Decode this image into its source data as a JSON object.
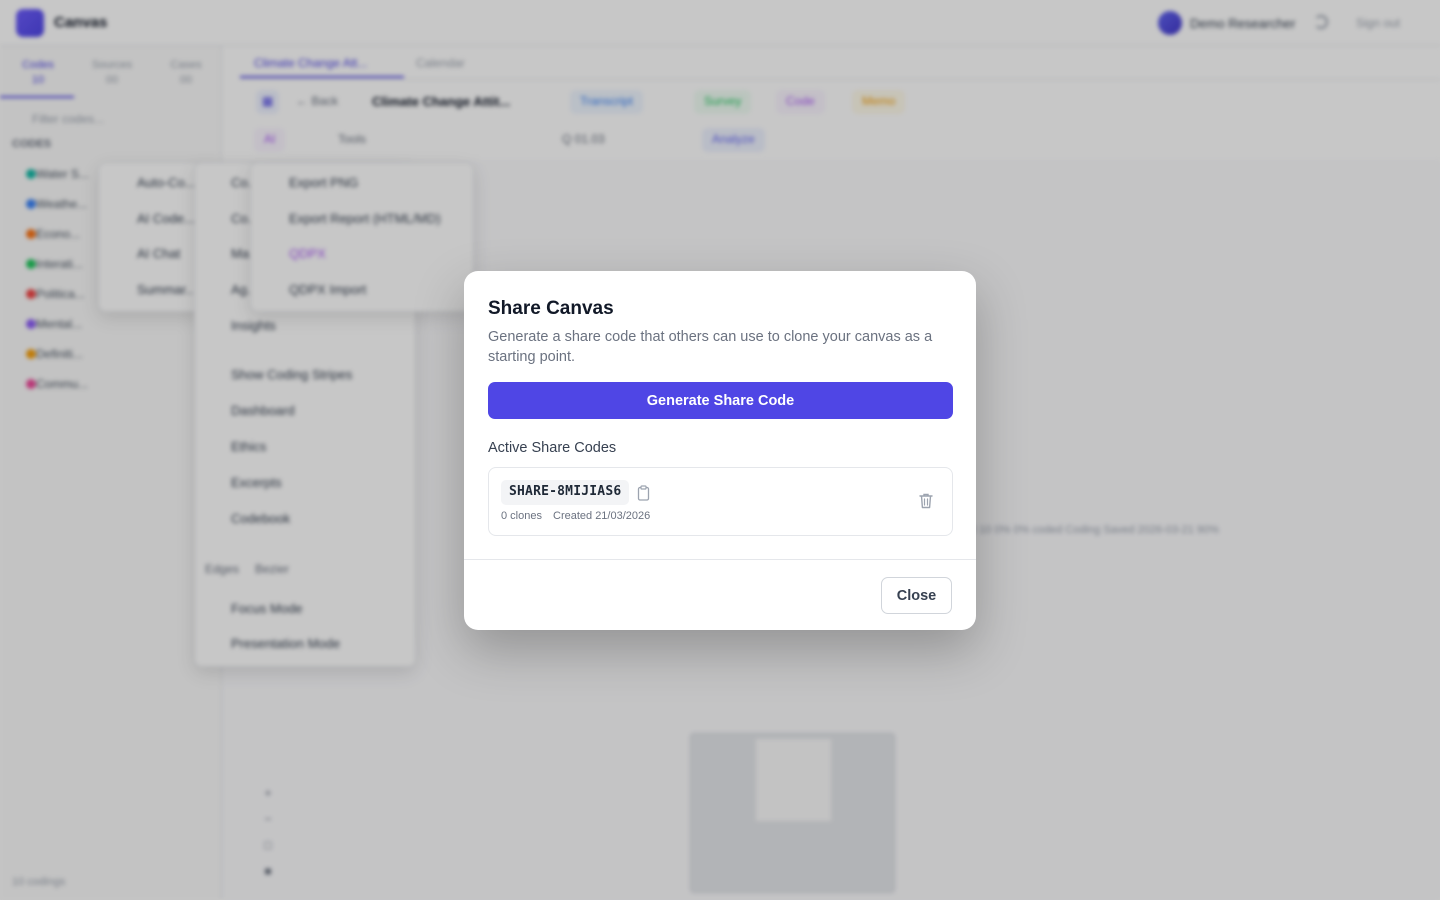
{
  "background": {
    "app_title": "Canvas",
    "user_name": "Demo Researcher",
    "sign_out": "Sign out",
    "sidebar_tabs": [
      {
        "label": "Codes",
        "count": "10"
      },
      {
        "label": "Sources",
        "count": "00"
      },
      {
        "label": "Cases",
        "count": "00"
      }
    ],
    "filter_placeholder": "Filter codes...",
    "codes_heading": "CODES",
    "codes": [
      {
        "label": "Water S...",
        "color": "#14b8a6"
      },
      {
        "label": "Weathe...",
        "color": "#3b82f6"
      },
      {
        "label": "Econo...",
        "color": "#f97316"
      },
      {
        "label": "Interati...",
        "color": "#22c55e"
      },
      {
        "label": "Politica...",
        "color": "#ef4444"
      },
      {
        "label": "Mental...",
        "color": "#8b5cf6"
      },
      {
        "label": "Definiti...",
        "color": "#f59e0b"
      },
      {
        "label": "Commu...",
        "color": "#ec4899"
      }
    ],
    "sidebar_footer": "10 codings",
    "doc_tabs": [
      "Climate Change Att...",
      "Calendar"
    ],
    "back_label": "Back",
    "doc_title": "Climate Change Attit...",
    "toolbar_pills": [
      {
        "label": "Transcript",
        "color": "#3b82f6"
      },
      {
        "label": "Survey",
        "color": "#22c55e"
      },
      {
        "label": "Code",
        "color": "#a855f7"
      },
      {
        "label": "Memo",
        "color": "#f59e0b"
      }
    ],
    "toolbar2": {
      "ai": "AI",
      "tools": "Tools",
      "zoom": "Q 01.03",
      "analyze": "Analyze"
    },
    "menu_left": [
      "Auto-Co...",
      "AI Code...",
      "AI Chat",
      "Summar..."
    ],
    "menu_mid": [
      "Co...",
      "Co...",
      "Ma...",
      "Ag...",
      "Insights",
      "Show Coding Stripes",
      "Dashboard",
      "Ethics",
      "Excerpts",
      "Codebook",
      "Focus Mode",
      "Presentation Mode"
    ],
    "edges_label": "Edges",
    "edges_value": "Bezier",
    "menu_right": [
      "Export PNG",
      "Export Report (HTML/MD)",
      "QDPX",
      "QDPX Import"
    ],
    "status_strip": "0   10   0%   0% coded   Coding   Saved   2026-03-21   90%"
  },
  "modal": {
    "title": "Share Canvas",
    "description": "Generate a share code that others can use to clone your canvas as a starting point.",
    "generate_button": "Generate Share Code",
    "section_label": "Active Share Codes",
    "share_codes": [
      {
        "code": "SHARE-8MIJIAS6",
        "clones": "0 clones",
        "created": "Created 21/03/2026"
      }
    ],
    "close_button": "Close",
    "accent_color": "#4f46e5"
  }
}
